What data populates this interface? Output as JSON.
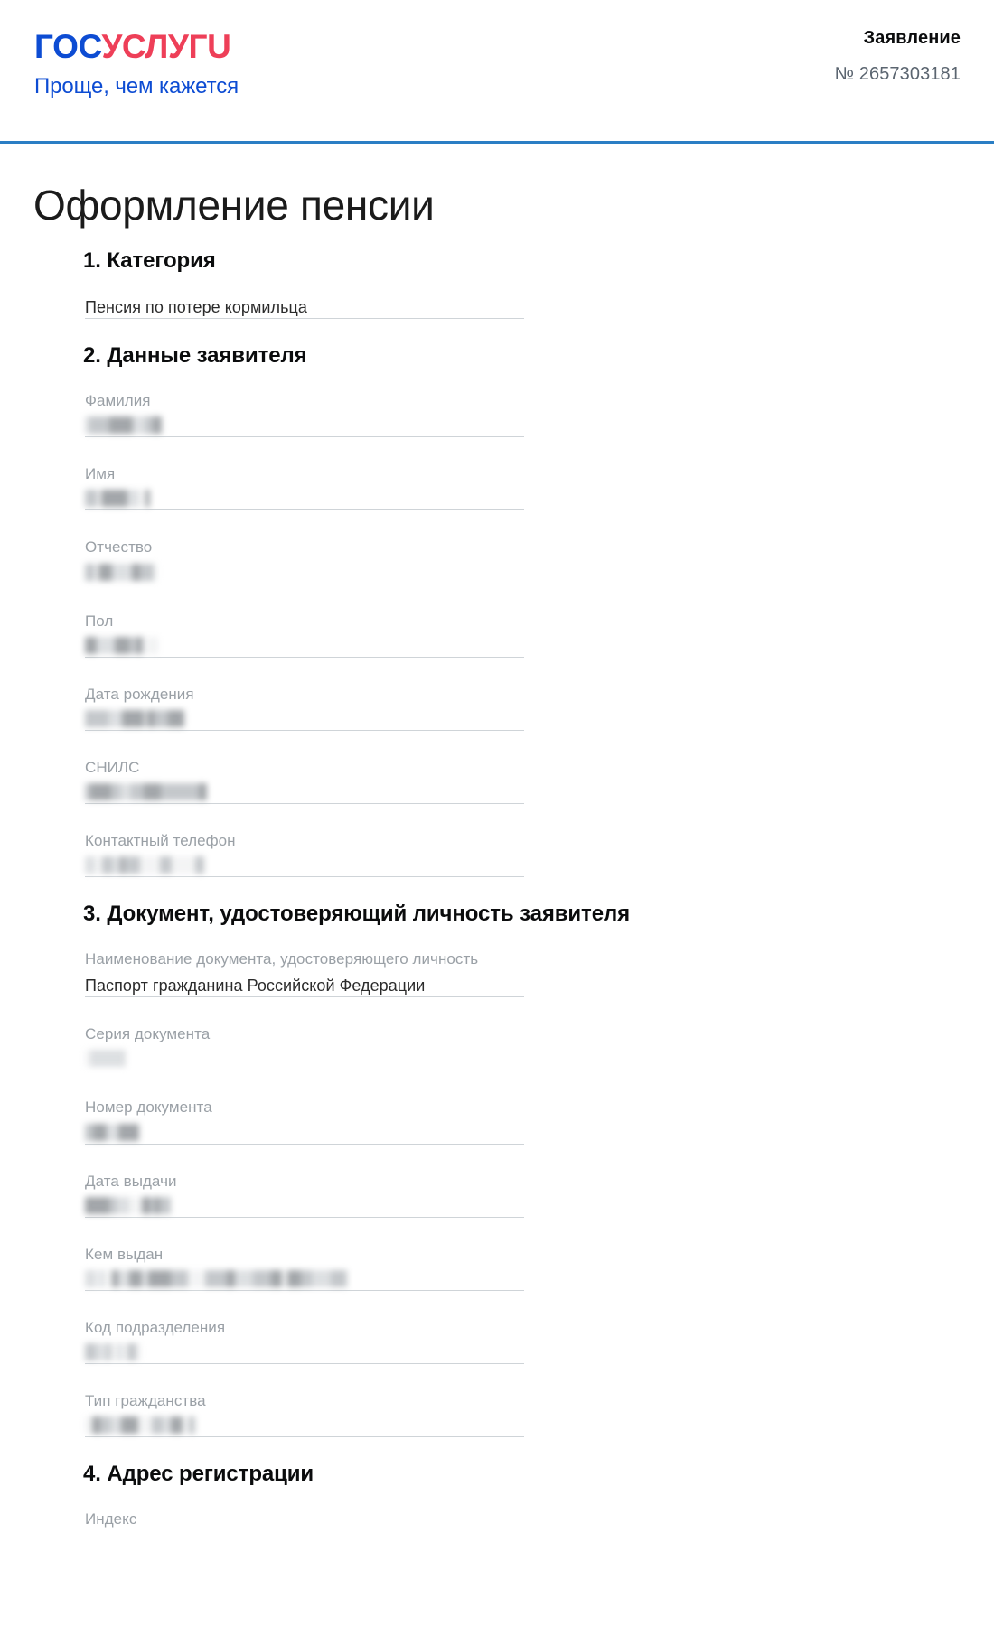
{
  "header": {
    "brand": {
      "logo_blue": "ГОС",
      "logo_red": "УСЛУГU",
      "tagline": "Проще, чем кажется"
    },
    "document_type": "Заявление",
    "document_number": "№ 2657303181",
    "accent_rule_color": "#2a7ec4",
    "brand_blue": "#0d4cd3",
    "brand_red": "#ee3f58"
  },
  "page": {
    "title": "Оформление пенсии"
  },
  "sections": [
    {
      "heading": "1. Категория",
      "fields": [
        {
          "label": "",
          "value": "Пенсия по потере кормильца",
          "redacted": false
        }
      ]
    },
    {
      "heading": "2. Данные заявителя",
      "fields": [
        {
          "label": "Фамилия",
          "value": "",
          "redacted": true,
          "redacted_width": 85
        },
        {
          "label": "Имя",
          "value": "",
          "redacted": true,
          "redacted_width": 72
        },
        {
          "label": "Отчество",
          "value": "",
          "redacted": true,
          "redacted_width": 80
        },
        {
          "label": "Пол",
          "value": "",
          "redacted": true,
          "redacted_width": 80
        },
        {
          "label": "Дата рождения",
          "value": "",
          "redacted": true,
          "redacted_width": 110
        },
        {
          "label": "СНИЛС",
          "value": "",
          "redacted": true,
          "redacted_width": 135
        },
        {
          "label": "Контактный телефон",
          "value": "",
          "redacted": true,
          "redacted_width": 132
        }
      ]
    },
    {
      "heading": "3. Документ, удостоверяющий личность заявителя",
      "fields": [
        {
          "label": "Наименование документа, удостоверяющего личность",
          "value": "Паспорт гражданина Российской Федерации",
          "redacted": false
        },
        {
          "label": "Серия документа",
          "value": "",
          "redacted": true,
          "redacted_width": 45
        },
        {
          "label": "Номер документа",
          "value": "",
          "redacted": true,
          "redacted_width": 60
        },
        {
          "label": "Дата выдачи",
          "value": "",
          "redacted": true,
          "redacted_width": 95
        },
        {
          "label": "Кем выдан",
          "value": "",
          "redacted": true,
          "redacted_width": 290
        },
        {
          "label": "Код подразделения",
          "value": "",
          "redacted": true,
          "redacted_width": 62
        },
        {
          "label": "Тип гражданства",
          "value": "",
          "redacted": true,
          "redacted_width": 122
        }
      ]
    },
    {
      "heading": "4. Адрес регистрации",
      "fields": [
        {
          "label": "Индекс",
          "value": "",
          "redacted": false
        }
      ]
    }
  ]
}
